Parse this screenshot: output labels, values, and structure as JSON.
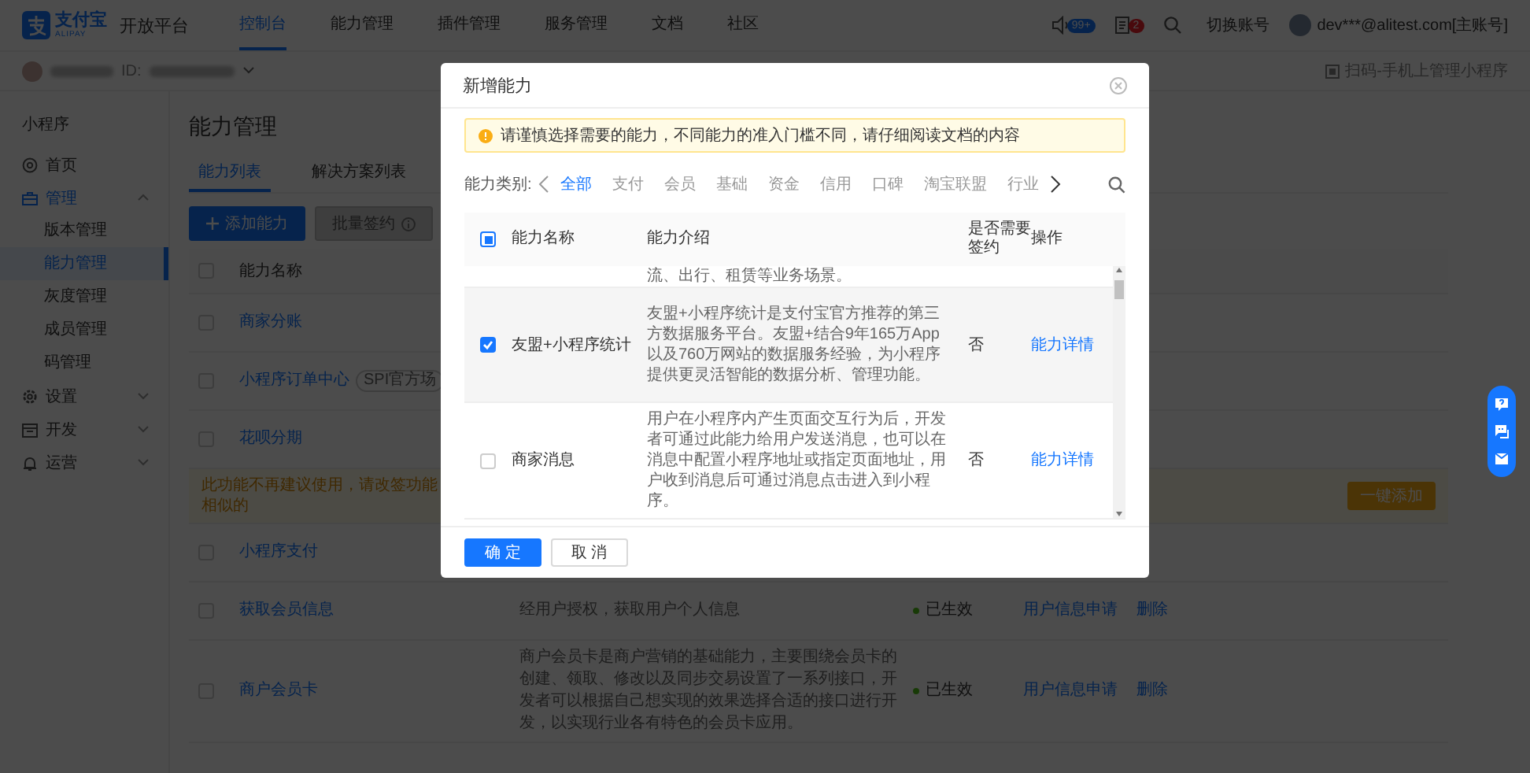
{
  "top_nav": {
    "logo": "支付宝",
    "logo_caption": "ALIPAY",
    "product": "开放平台",
    "items": [
      {
        "label": "控制台",
        "selected": true
      },
      {
        "label": "能力管理",
        "selected": false
      },
      {
        "label": "插件管理",
        "selected": false
      },
      {
        "label": "服务管理",
        "selected": false
      },
      {
        "label": "文档",
        "selected": false
      },
      {
        "label": "社区",
        "selected": false
      }
    ],
    "notice_badge": "99+",
    "message_badge": "2",
    "switch_account": "切换账号",
    "account": "dev***@alitest.com[主账号]"
  },
  "app_bar": {
    "id_label": "ID:",
    "scan_link": "扫码-手机上管理小程序"
  },
  "sidebar": {
    "section": "小程序",
    "items": [
      {
        "label": "首页",
        "selected": false
      },
      {
        "label": "管理",
        "expanded": true,
        "children": [
          {
            "label": "版本管理",
            "selected": false
          },
          {
            "label": "能力管理",
            "selected": true
          },
          {
            "label": "灰度管理",
            "selected": false
          },
          {
            "label": "成员管理",
            "selected": false
          },
          {
            "label": "码管理",
            "selected": false
          }
        ]
      },
      {
        "label": "设置",
        "expanded": false
      },
      {
        "label": "开发",
        "expanded": false
      },
      {
        "label": "运营",
        "expanded": false
      }
    ]
  },
  "page": {
    "title": "能力管理",
    "tabs": [
      {
        "label": "能力列表",
        "selected": true
      },
      {
        "label": "解决方案列表",
        "selected": false
      }
    ],
    "buttons": [
      {
        "label": "添加能力",
        "kind": "primary",
        "disabled": false
      },
      {
        "label": "批量签约",
        "kind": "default",
        "disabled": true
      }
    ],
    "table": {
      "columns": [
        "能力名称"
      ],
      "select_all": {
        "checked": false
      },
      "rows": [
        {
          "kind": "ability",
          "name": "商家分账",
          "checked": false
        },
        {
          "kind": "ability",
          "name": "小程序订单中心",
          "tag": "SPI官方场",
          "checked": false
        },
        {
          "kind": "ability",
          "name": "花呗分期",
          "checked": false
        },
        {
          "kind": "notice",
          "text": "此功能不再建议使用，请改签功能相似的",
          "action": "一键添加"
        },
        {
          "kind": "ability",
          "name": "小程序支付",
          "checked": false
        },
        {
          "kind": "ability",
          "name": "获取会员信息",
          "description": "经用户授权，获取用户个人信息",
          "status": "已生效",
          "actions": [
            "用户信息申请",
            "删除"
          ],
          "checked": false
        },
        {
          "kind": "ability",
          "name": "商户会员卡",
          "description": "商户会员卡是商户营销的基础能力，主要围绕会员卡的创建、领取、修改以及同步交易设置了一系列接口，开发者可以根据自己想实现的效果选择合适的接口进行开发，以实现行业各有特色的会员卡应用。",
          "status": "已生效",
          "actions": [
            "用户信息申请",
            "删除"
          ],
          "checked": false
        }
      ]
    }
  },
  "dialog": {
    "title": "新增能力",
    "alert": "请谨慎选择需要的能力，不同能力的准入门槛不同，请仔细阅读文档的内容",
    "category_label": "能力类别:",
    "categories": [
      {
        "label": "全部",
        "selected": true
      },
      {
        "label": "支付",
        "selected": false
      },
      {
        "label": "会员",
        "selected": false
      },
      {
        "label": "基础",
        "selected": false
      },
      {
        "label": "资金",
        "selected": false
      },
      {
        "label": "信用",
        "selected": false
      },
      {
        "label": "口碑",
        "selected": false
      },
      {
        "label": "淘宝联盟",
        "selected": false
      },
      {
        "label": "行业",
        "selected": false
      }
    ],
    "table": {
      "columns": [
        "能力名称",
        "能力介绍",
        "是否需要签约",
        "操作"
      ],
      "select_all": {
        "indeterminate": true
      },
      "rows": [
        {
          "description": "流、出行、租赁等业务场景。"
        },
        {
          "name": "友盟+小程序统计",
          "description": "友盟+小程序统计是支付宝官方推荐的第三方数据服务平台。友盟+结合9年165万App以及760万网站的数据服务经验，为小程序提供更灵活智能的数据分析、管理功能。",
          "sign": "否",
          "action": "能力详情",
          "checked": true
        },
        {
          "name": "商家消息",
          "description": "用户在小程序内产生页面交互行为后，开发者可通过此能力给用户发送消息，也可以在消息中配置小程序地址或指定页面地址，用户收到消息后可通过消息点击进入到小程序。",
          "sign": "否",
          "action": "能力详情",
          "checked": false
        }
      ]
    },
    "buttons": [
      {
        "label": "确 定",
        "kind": "primary"
      },
      {
        "label": "取 消",
        "kind": "default"
      }
    ]
  }
}
